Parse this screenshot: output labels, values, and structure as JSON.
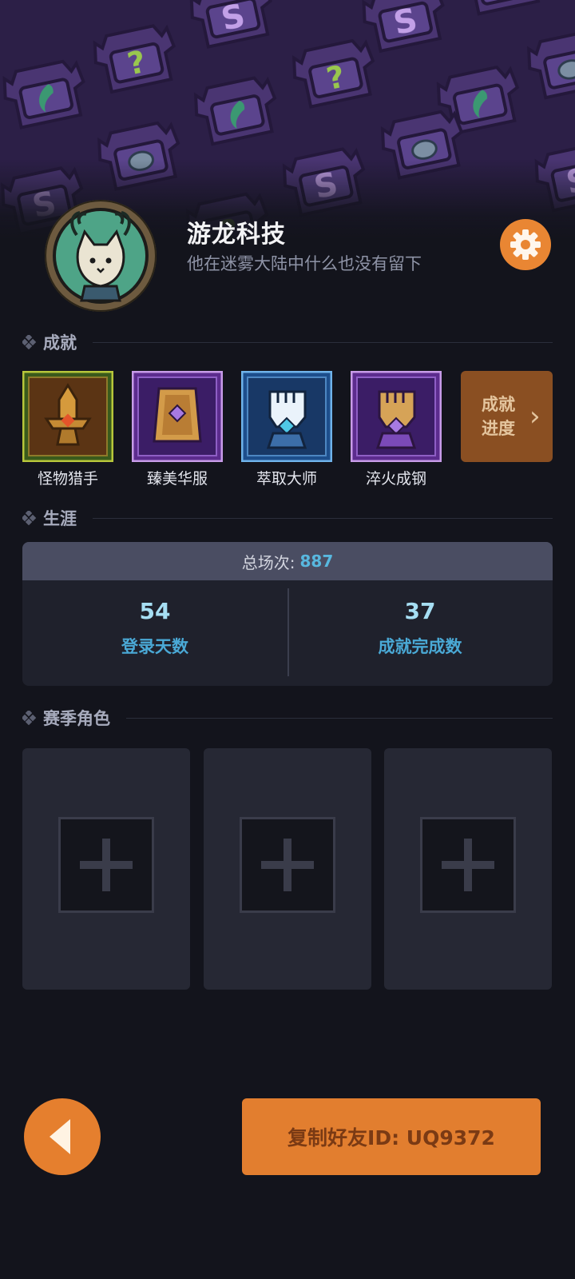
{
  "profile": {
    "name": "游龙科技",
    "motto": "他在迷雾大陆中什么也没有留下"
  },
  "achievements": {
    "section_title": "成就",
    "items": [
      {
        "label": "怪物猎手",
        "frame": "gold"
      },
      {
        "label": "臻美华服",
        "frame": "purple"
      },
      {
        "label": "萃取大师",
        "frame": "blue"
      },
      {
        "label": "淬火成钢",
        "frame": "purple"
      }
    ],
    "progress_line1": "成就",
    "progress_line2": "进度"
  },
  "career": {
    "section_title": "生涯",
    "total_label": "总场次:",
    "total_value": "887",
    "stats": [
      {
        "value": "54",
        "label": "登录天数"
      },
      {
        "value": "37",
        "label": "成就完成数"
      }
    ]
  },
  "season_roles": {
    "section_title": "赛季角色",
    "slots": [
      "empty",
      "empty",
      "empty"
    ]
  },
  "footer": {
    "copy_id_label": "复制好友ID: UQ9372"
  },
  "colors": {
    "accent_orange": "#e57f2e",
    "career_value": "#a6def3",
    "career_label": "#4aa9d6",
    "total_value": "#58b8df"
  },
  "icons": {
    "settings": "gear-icon",
    "back": "arrow-left-icon",
    "add": "plus-icon"
  }
}
